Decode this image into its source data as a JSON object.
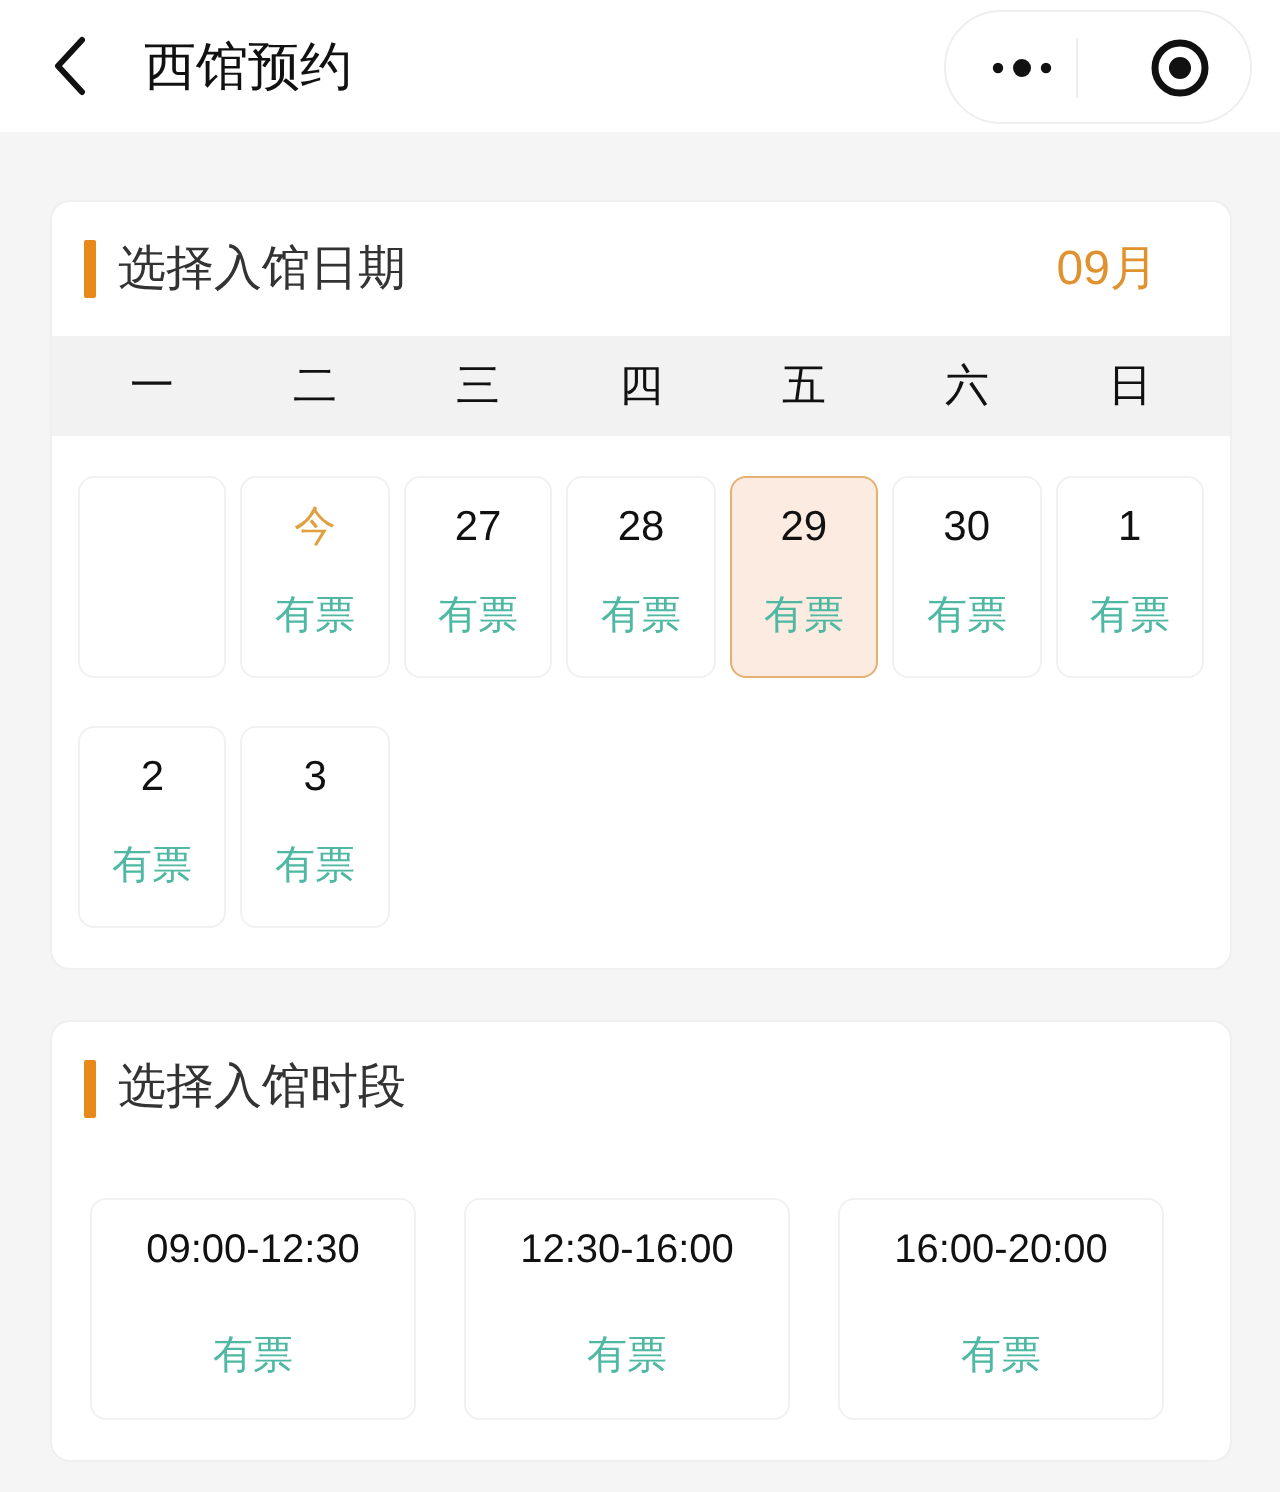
{
  "header": {
    "title": "西馆预约"
  },
  "date_section": {
    "title": "选择入馆日期",
    "month": "09月",
    "weekdays": [
      "一",
      "二",
      "三",
      "四",
      "五",
      "六",
      "日"
    ],
    "days": [
      {
        "kind": "blank"
      },
      {
        "kind": "day",
        "label": "今",
        "today": true,
        "status": "有票",
        "selected": false
      },
      {
        "kind": "day",
        "label": "27",
        "today": false,
        "status": "有票",
        "selected": false
      },
      {
        "kind": "day",
        "label": "28",
        "today": false,
        "status": "有票",
        "selected": false
      },
      {
        "kind": "day",
        "label": "29",
        "today": false,
        "status": "有票",
        "selected": true
      },
      {
        "kind": "day",
        "label": "30",
        "today": false,
        "status": "有票",
        "selected": false
      },
      {
        "kind": "day",
        "label": "1",
        "today": false,
        "status": "有票",
        "selected": false
      },
      {
        "kind": "day",
        "label": "2",
        "today": false,
        "status": "有票",
        "selected": false
      },
      {
        "kind": "day",
        "label": "3",
        "today": false,
        "status": "有票",
        "selected": false
      }
    ]
  },
  "time_section": {
    "title": "选择入馆时段",
    "slots": [
      {
        "time": "09:00-12:30",
        "status": "有票",
        "selected": false
      },
      {
        "time": "12:30-16:00",
        "status": "有票",
        "selected": false
      },
      {
        "time": "16:00-20:00",
        "status": "有票",
        "selected": false
      }
    ]
  }
}
